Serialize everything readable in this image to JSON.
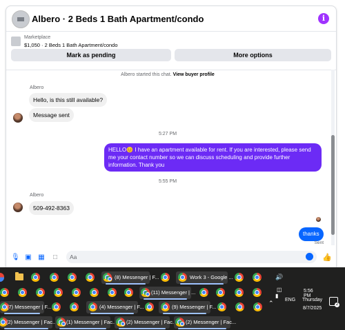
{
  "chat": {
    "title": "Albero · 2 Beds 1 Bath Apartment/condo",
    "info_icon": "i",
    "marketplace": {
      "label": "Marketplace",
      "listing": "$1,050 · 2 Beds 1 Bath Apartment/condo",
      "mark_pending": "Mark as pending",
      "more_options": "More options"
    },
    "started_text": "Albero started this chat.",
    "view_profile": "View buyer profile",
    "messages": {
      "sender1": "Albero",
      "m1": "Hello, is this still available?",
      "m2": "Message sent",
      "time1": "5:27 PM",
      "m3": "HELLO😊 I have an apartment available for rent. If you are interested, please send me your contact number so we can discuss scheduling and provide further information. Thank you",
      "time2": "5:55 PM",
      "sender2": "Albero",
      "m4": "509-492-8363",
      "m5": "thanks",
      "status": "Sent"
    },
    "composer": {
      "placeholder": "Aa"
    }
  },
  "taskbar": {
    "row1": [
      {
        "label": "(8) Messenger | F..."
      },
      {
        "label": "Work 3 - Google ..."
      }
    ],
    "row2": [
      {
        "label": "(11) Messenger | ..."
      }
    ],
    "row3": [
      {
        "label": "(7) Messenger | F..."
      },
      {
        "label": "(4) Messenger | F..."
      },
      {
        "label": "(9) Messenger | F..."
      }
    ],
    "row4": [
      {
        "label": "(2) Messenger | Fac..."
      },
      {
        "label": "(1) Messenger | Fac..."
      },
      {
        "label": "(2) Messenger | Fac..."
      },
      {
        "label": "(2) Messenger | Fac..."
      }
    ],
    "tray": {
      "language": "ENG",
      "time": "5:56 PM",
      "day": "Thursday",
      "date": "8/7/2025",
      "notification_count": "2"
    }
  }
}
